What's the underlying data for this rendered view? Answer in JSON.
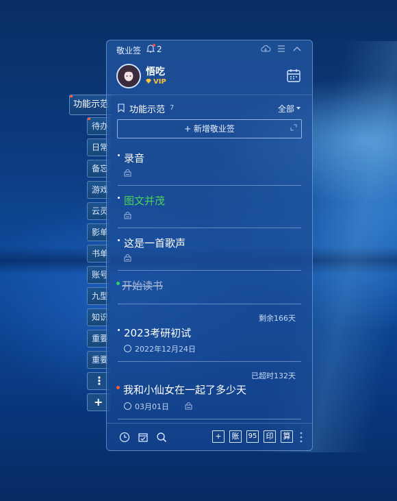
{
  "side_tabs": {
    "active": "功能示范",
    "items": [
      "待办",
      "日常",
      "备忘",
      "游戏",
      "云灵",
      "影单",
      "书单",
      "账号",
      "九型",
      "知识",
      "重要",
      "重要"
    ],
    "more_label": "⋮",
    "add_label": "+"
  },
  "panel": {
    "title": "敬业签",
    "notification_count": "2"
  },
  "user": {
    "name": "悟吃",
    "badge": "VIP"
  },
  "list": {
    "name": "功能示范",
    "count": "7",
    "filter": "全部",
    "add_button": "+ 新增敬业签"
  },
  "notes": [
    {
      "title": "录音",
      "color": "#ffffff"
    },
    {
      "title": "图文并茂",
      "color": "#4ccf5c"
    },
    {
      "title": "这是一首歌声",
      "color": "#ffffff"
    },
    {
      "title": "开始读书",
      "color": "#aab9d6",
      "strikethrough": true,
      "bullet_color": "#2ed06e"
    },
    {
      "title": "2023考研初试",
      "meta": "剩余166天",
      "date": "2022年12月24日"
    },
    {
      "title": "我和小仙女在一起了多少天",
      "meta": "已超时132天",
      "date": "03月01日",
      "bullet_color": "#ff5a3c"
    }
  ],
  "footer": {
    "buttons": [
      "+",
      "账",
      "95",
      "印",
      "算"
    ]
  },
  "colors": {
    "accent_green": "#4ccf5c",
    "alert_red": "#ff5a3c",
    "vip_gold": "#f7c33c"
  }
}
